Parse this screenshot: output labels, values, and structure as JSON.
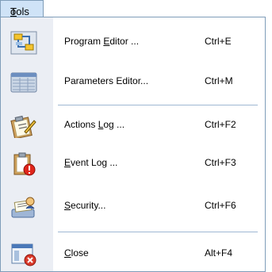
{
  "menubar": {
    "tools_prefix": "T",
    "tools_rest": "ools"
  },
  "items": [
    {
      "pre": "Program ",
      "ul": "E",
      "post": "ditor ...",
      "shortcut": "Ctrl+E",
      "icon": "program-editor-icon"
    },
    {
      "pre": "Parameters Editor...",
      "ul": "",
      "post": "",
      "shortcut": "Ctrl+M",
      "icon": "parameters-editor-icon"
    },
    {
      "pre": "Actions ",
      "ul": "L",
      "post": "og ...",
      "shortcut": "Ctrl+F2",
      "icon": "actions-log-icon"
    },
    {
      "pre": "",
      "ul": "E",
      "post": "vent Log ...",
      "shortcut": "Ctrl+F3",
      "icon": "event-log-icon"
    },
    {
      "pre": "",
      "ul": "S",
      "post": "ecurity...",
      "shortcut": "Ctrl+F6",
      "icon": "security-icon"
    },
    {
      "pre": "",
      "ul": "C",
      "post": "lose",
      "shortcut": "Alt+F4",
      "icon": "close-icon"
    }
  ]
}
